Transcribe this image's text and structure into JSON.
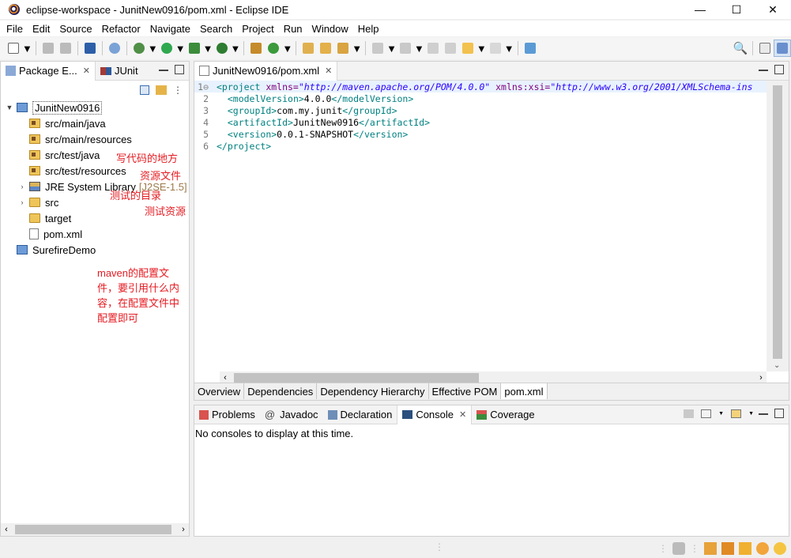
{
  "window": {
    "title": "eclipse-workspace - JunitNew0916/pom.xml - Eclipse IDE",
    "minimize": "—",
    "maximize": "☐",
    "close": "✕"
  },
  "menu": [
    "File",
    "Edit",
    "Source",
    "Refactor",
    "Navigate",
    "Search",
    "Project",
    "Run",
    "Window",
    "Help"
  ],
  "package_explorer": {
    "tabs": [
      {
        "label": "Package E...",
        "close": "✕",
        "icon": "package-icon"
      },
      {
        "label": "JUnit",
        "icon": "junit-icon"
      }
    ],
    "tree": [
      {
        "label": "JunitNew0916",
        "icon": "project-icon",
        "expanded": true,
        "selected": true
      },
      {
        "label": "src/main/java",
        "icon": "source-folder-icon",
        "note": "写代码的地方"
      },
      {
        "label": "src/main/resources",
        "icon": "source-folder-icon",
        "note": "资源文件"
      },
      {
        "label": "src/test/java",
        "icon": "source-folder-icon",
        "note": "测试的目录"
      },
      {
        "label": "src/test/resources",
        "icon": "source-folder-icon",
        "note": "测试资源"
      },
      {
        "label": "JRE System Library",
        "suffix": "[J2SE-1.5]",
        "icon": "library-icon",
        "expandable": true
      },
      {
        "label": "src",
        "icon": "folder-icon",
        "expandable": true
      },
      {
        "label": "target",
        "icon": "folder-icon"
      },
      {
        "label": "pom.xml",
        "icon": "xml-file-icon",
        "note": "maven的配置文件，要引用什么内容，在配置文件中配置即可"
      },
      {
        "label": "SurefireDemo",
        "icon": "project-icon"
      }
    ]
  },
  "editor": {
    "tab_label": "JunitNew0916/pom.xml",
    "tab_close": "✕",
    "lines": [
      {
        "num": "1",
        "fold": "⊖"
      },
      {
        "num": "2"
      },
      {
        "num": "3"
      },
      {
        "num": "4"
      },
      {
        "num": "5"
      },
      {
        "num": "6"
      }
    ],
    "code": {
      "l1_open": "<project ",
      "l1_attr1": "xmlns=",
      "l1_val1": "\"http://maven.apache.org/POM/4.0.0\"",
      "l1_attr2": " xmlns:xsi=",
      "l1_val2": "\"http://www.w3.org/2001/XMLSchema-ins",
      "l2_open": "<modelVersion>",
      "l2_text": "4.0.0",
      "l2_close": "</modelVersion>",
      "l3_open": "<groupId>",
      "l3_text": "com.my.junit",
      "l3_close": "</groupId>",
      "l4_open": "<artifactId>",
      "l4_text": "JunitNew0916",
      "l4_close": "</artifactId>",
      "l5_open": "<version>",
      "l5_text": "0.0.1-SNAPSHOT",
      "l5_close": "</version>",
      "l6_close": "</project>"
    },
    "bottom_tabs": [
      "Overview",
      "Dependencies",
      "Dependency Hierarchy",
      "Effective POM",
      "pom.xml"
    ],
    "active_bottom_tab": "pom.xml"
  },
  "console_view": {
    "tabs": [
      "Problems",
      "Javadoc",
      "Declaration",
      "Console",
      "Coverage"
    ],
    "tab_prefixes": {
      "javadoc": "@"
    },
    "active_tab": "Console",
    "close": "✕",
    "message": "No consoles to display at this time."
  }
}
